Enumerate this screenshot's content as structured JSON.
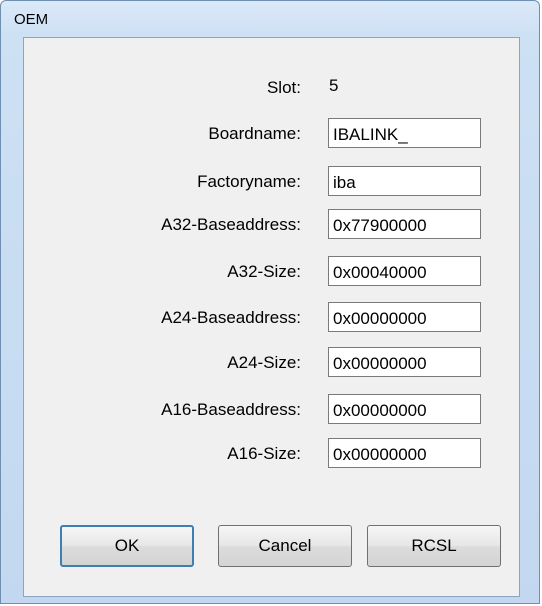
{
  "window": {
    "title": "OEM"
  },
  "slot": {
    "label": "Slot:",
    "value": "5"
  },
  "fields": [
    {
      "label": "Boardname:",
      "value": "IBALINK_"
    },
    {
      "label": "Factoryname:",
      "value": "iba"
    },
    {
      "label": "A32-Baseaddress:",
      "value": "0x77900000"
    },
    {
      "label": "A32-Size:",
      "value": "0x00040000"
    },
    {
      "label": "A24-Baseaddress:",
      "value": "0x00000000"
    },
    {
      "label": "A24-Size:",
      "value": "0x00000000"
    },
    {
      "label": "A16-Baseaddress:",
      "value": "0x00000000"
    },
    {
      "label": "A16-Size:",
      "value": "0x00000000"
    }
  ],
  "buttons": {
    "ok": "OK",
    "cancel": "Cancel",
    "rcsl": "RCSL"
  }
}
